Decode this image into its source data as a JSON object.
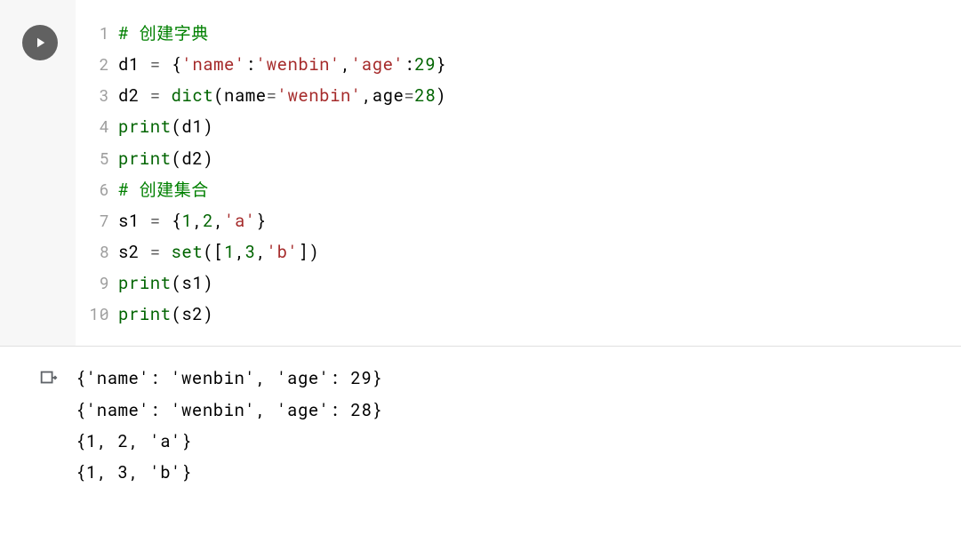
{
  "code": {
    "lines": [
      {
        "n": "1",
        "tokens": [
          {
            "t": "# 创建字典",
            "c": "tok-comment"
          }
        ]
      },
      {
        "n": "2",
        "tokens": [
          {
            "t": "d1",
            "c": "tok-name"
          },
          {
            "t": " ",
            "c": ""
          },
          {
            "t": "=",
            "c": "tok-op"
          },
          {
            "t": " ",
            "c": ""
          },
          {
            "t": "{",
            "c": "tok-punct"
          },
          {
            "t": "'name'",
            "c": "tok-string"
          },
          {
            "t": ":",
            "c": "tok-punct"
          },
          {
            "t": "'wenbin'",
            "c": "tok-string"
          },
          {
            "t": ",",
            "c": "tok-punct"
          },
          {
            "t": "'age'",
            "c": "tok-string"
          },
          {
            "t": ":",
            "c": "tok-punct"
          },
          {
            "t": "29",
            "c": "tok-number"
          },
          {
            "t": "}",
            "c": "tok-punct"
          }
        ]
      },
      {
        "n": "3",
        "tokens": [
          {
            "t": "d2",
            "c": "tok-name"
          },
          {
            "t": " ",
            "c": ""
          },
          {
            "t": "=",
            "c": "tok-op"
          },
          {
            "t": " ",
            "c": ""
          },
          {
            "t": "dict",
            "c": "tok-builtin"
          },
          {
            "t": "(",
            "c": "tok-punct"
          },
          {
            "t": "name",
            "c": "tok-name"
          },
          {
            "t": "=",
            "c": "tok-op"
          },
          {
            "t": "'wenbin'",
            "c": "tok-string"
          },
          {
            "t": ",",
            "c": "tok-punct"
          },
          {
            "t": "age",
            "c": "tok-name"
          },
          {
            "t": "=",
            "c": "tok-op"
          },
          {
            "t": "28",
            "c": "tok-number"
          },
          {
            "t": ")",
            "c": "tok-punct"
          }
        ]
      },
      {
        "n": "4",
        "tokens": [
          {
            "t": "print",
            "c": "tok-builtin"
          },
          {
            "t": "(",
            "c": "tok-punct"
          },
          {
            "t": "d1",
            "c": "tok-name"
          },
          {
            "t": ")",
            "c": "tok-punct"
          }
        ]
      },
      {
        "n": "5",
        "tokens": [
          {
            "t": "print",
            "c": "tok-builtin"
          },
          {
            "t": "(",
            "c": "tok-punct"
          },
          {
            "t": "d2",
            "c": "tok-name"
          },
          {
            "t": ")",
            "c": "tok-punct"
          }
        ]
      },
      {
        "n": "6",
        "tokens": [
          {
            "t": "# 创建集合",
            "c": "tok-comment"
          }
        ]
      },
      {
        "n": "7",
        "tokens": [
          {
            "t": "s1",
            "c": "tok-name"
          },
          {
            "t": " ",
            "c": ""
          },
          {
            "t": "=",
            "c": "tok-op"
          },
          {
            "t": " ",
            "c": ""
          },
          {
            "t": "{",
            "c": "tok-punct"
          },
          {
            "t": "1",
            "c": "tok-number"
          },
          {
            "t": ",",
            "c": "tok-punct"
          },
          {
            "t": "2",
            "c": "tok-number"
          },
          {
            "t": ",",
            "c": "tok-punct"
          },
          {
            "t": "'a'",
            "c": "tok-string"
          },
          {
            "t": "}",
            "c": "tok-punct"
          }
        ]
      },
      {
        "n": "8",
        "tokens": [
          {
            "t": "s2",
            "c": "tok-name"
          },
          {
            "t": " ",
            "c": ""
          },
          {
            "t": "=",
            "c": "tok-op"
          },
          {
            "t": " ",
            "c": ""
          },
          {
            "t": "set",
            "c": "tok-builtin"
          },
          {
            "t": "(",
            "c": "tok-punct"
          },
          {
            "t": "[",
            "c": "tok-punct"
          },
          {
            "t": "1",
            "c": "tok-number"
          },
          {
            "t": ",",
            "c": "tok-punct"
          },
          {
            "t": "3",
            "c": "tok-number"
          },
          {
            "t": ",",
            "c": "tok-punct"
          },
          {
            "t": "'b'",
            "c": "tok-string"
          },
          {
            "t": "]",
            "c": "tok-punct"
          },
          {
            "t": ")",
            "c": "tok-punct"
          }
        ]
      },
      {
        "n": "9",
        "tokens": [
          {
            "t": "print",
            "c": "tok-builtin"
          },
          {
            "t": "(",
            "c": "tok-punct"
          },
          {
            "t": "s1",
            "c": "tok-name"
          },
          {
            "t": ")",
            "c": "tok-punct"
          }
        ]
      },
      {
        "n": "10",
        "tokens": [
          {
            "t": "print",
            "c": "tok-builtin"
          },
          {
            "t": "(",
            "c": "tok-punct"
          },
          {
            "t": "s2",
            "c": "tok-name"
          },
          {
            "t": ")",
            "c": "tok-punct"
          }
        ]
      }
    ]
  },
  "output": {
    "text": "{'name': 'wenbin', 'age': 29}\n{'name': 'wenbin', 'age': 28}\n{1, 2, 'a'}\n{1, 3, 'b'}"
  }
}
